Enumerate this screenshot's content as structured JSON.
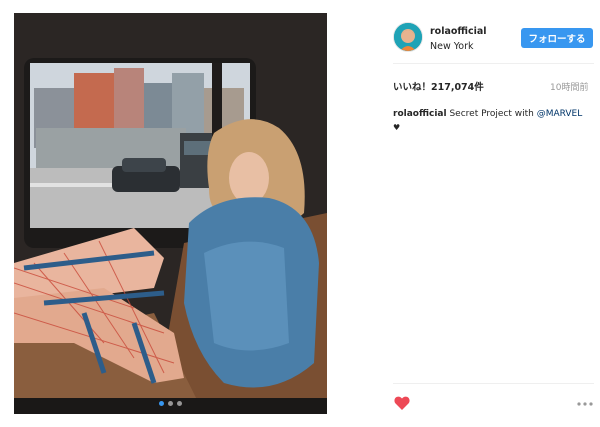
{
  "post": {
    "username": "rolaofficial",
    "location": "New York",
    "follow_label": "フォローする",
    "likes_text": "いいね！217,074件",
    "time_text": "10時間前",
    "caption": {
      "username": "rolaofficial",
      "text": "Secret Project with",
      "mention": "@MARVEL",
      "trailing_symbol": "♥"
    }
  },
  "carousel": {
    "slide_count": 3,
    "active_index": 0
  },
  "colors": {
    "accent": "#3897f0",
    "heart": "#ed4956",
    "muted": "#999999"
  },
  "icons": {
    "like": "heart-icon",
    "more": "more-options-icon"
  }
}
